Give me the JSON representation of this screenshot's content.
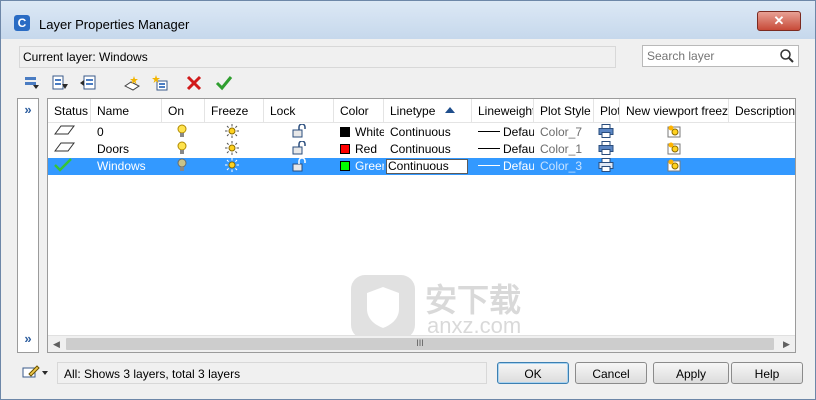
{
  "window": {
    "title": "Layer Properties Manager",
    "close_glyph": "✕"
  },
  "current_layer": {
    "text": "Current layer: Windows"
  },
  "search": {
    "placeholder": "Search layer"
  },
  "toolbar": {
    "icons": [
      "new-property-filter-icon",
      "new-group-filter-icon",
      "layer-states-manager-icon",
      "new-layer-icon",
      "new-layer-vp-frozen-icon",
      "delete-layer-icon",
      "set-current-icon"
    ]
  },
  "left_strip": {
    "expand_glyph": "»"
  },
  "columns": {
    "status": "Status",
    "name": "Name",
    "on": "On",
    "freeze": "Freeze",
    "lock": "Lock",
    "color": "Color",
    "linetype": "Linetype",
    "lineweight": "Lineweight",
    "plot_style": "Plot Style",
    "plot": "Plot",
    "new_vp_freeze": "New viewport freeze",
    "description": "Description"
  },
  "layers": [
    {
      "name": "0",
      "color_name": "White",
      "color_hex": "#000000",
      "linetype": "Continuous",
      "lineweight": "Default",
      "plot_style": "Color_7",
      "current": false
    },
    {
      "name": "Doors",
      "color_name": "Red",
      "color_hex": "#ff0000",
      "linetype": "Continuous",
      "lineweight": "Default",
      "plot_style": "Color_1",
      "current": false
    },
    {
      "name": "Windows",
      "color_name": "Green",
      "color_hex": "#00ff00",
      "linetype": "Continuous",
      "lineweight": "Default",
      "plot_style": "Color_3",
      "current": true
    }
  ],
  "scrollbar": {
    "left": "◀",
    "right": "▶",
    "grip": "III"
  },
  "watermark": {
    "text": "安下载",
    "url": "anxz.com"
  },
  "status_bar": {
    "text": "All: Shows 3 layers, total 3 layers"
  },
  "buttons": {
    "ok": "OK",
    "cancel": "Cancel",
    "apply": "Apply",
    "help": "Help"
  },
  "colors": {
    "selection": "#3399ff",
    "title_bar": "#c6d8ec"
  }
}
